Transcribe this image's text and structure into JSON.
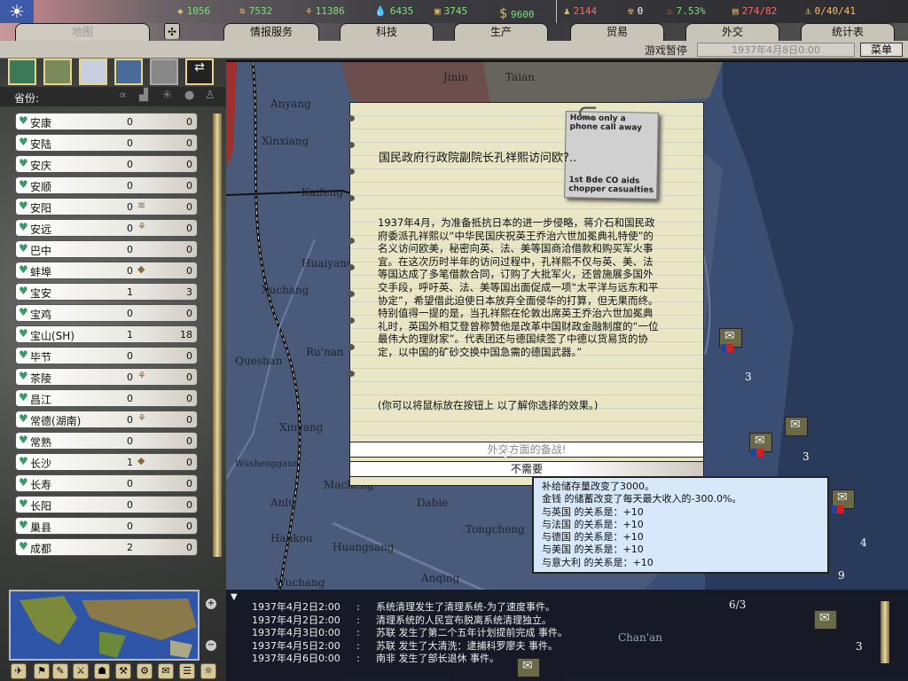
{
  "top": {
    "resources": [
      {
        "icon": "energy-icon",
        "value": "1056"
      },
      {
        "icon": "metal-icon",
        "value": "7532"
      },
      {
        "icon": "rare-materials-icon",
        "value": "11386"
      },
      {
        "icon": "oil-icon",
        "value": "6435"
      },
      {
        "icon": "supplies-icon",
        "value": "3745"
      },
      {
        "icon": "money-icon",
        "value": "9600"
      }
    ],
    "manpower": "2144",
    "nuclear": "0",
    "dissent": "7.53%",
    "transports": "274/82",
    "convoys": "0/40/41"
  },
  "tabs": [
    "地图",
    "情报服务",
    "科技",
    "生产",
    "贸易",
    "外交",
    "统计表"
  ],
  "subbar": {
    "paused": "游戏暂停",
    "date": "1937年4月8日0:00",
    "menu": "菜单"
  },
  "provinces": {
    "header": "省份:",
    "items": [
      {
        "name": "安康",
        "a": "0",
        "b": "0"
      },
      {
        "name": "安陆",
        "a": "0",
        "b": "0"
      },
      {
        "name": "安庆",
        "a": "0",
        "b": "0"
      },
      {
        "name": "安顺",
        "a": "0",
        "b": "0"
      },
      {
        "name": "安阳",
        "a": "0",
        "b": "0",
        "icon": "metal"
      },
      {
        "name": "安远",
        "a": "0",
        "b": "0",
        "icon": "rare"
      },
      {
        "name": "巴中",
        "a": "0",
        "b": "0"
      },
      {
        "name": "蚌埠",
        "a": "0",
        "b": "0",
        "icon": "energy"
      },
      {
        "name": "宝安",
        "a": "1",
        "b": "3"
      },
      {
        "name": "宝鸡",
        "a": "0",
        "b": "0"
      },
      {
        "name": "宝山(SH)",
        "a": "1",
        "b": "18"
      },
      {
        "name": "毕节",
        "a": "0",
        "b": "0"
      },
      {
        "name": "茶陵",
        "a": "0",
        "b": "0",
        "icon": "rare"
      },
      {
        "name": "昌江",
        "a": "0",
        "b": "0"
      },
      {
        "name": "常德(湖南)",
        "a": "0",
        "b": "0",
        "icon": "rare"
      },
      {
        "name": "常熟",
        "a": "0",
        "b": "0"
      },
      {
        "name": "长沙",
        "a": "1",
        "b": "0",
        "icon": "energy"
      },
      {
        "name": "长寿",
        "a": "0",
        "b": "0"
      },
      {
        "name": "长阳",
        "a": "0",
        "b": "0"
      },
      {
        "name": "巢县",
        "a": "0",
        "b": "0"
      },
      {
        "name": "成都",
        "a": "2",
        "b": "0"
      }
    ]
  },
  "map": {
    "cities": [
      "Anyang",
      "Xinxiang",
      "Kaifeng",
      "Xuchang",
      "Huaiyang",
      "Queshan",
      "Ru'nan",
      "Xinyang",
      "Wushenggaun",
      "Anlu",
      "Macheng",
      "Hankou",
      "Huangsang",
      "Anqing",
      "Tongcheng",
      "Chan'an",
      "Dabie",
      "Jinin",
      "Taian",
      "Wuchang"
    ]
  },
  "event": {
    "title": "国民政府行政院副院长孔祥熙访问欧?..",
    "newspaper": {
      "headline": "Home only a phone call away",
      "sub": "1st Bde CO aids chopper casualties"
    },
    "body": "1937年4月，为准备抵抗日本的进一步侵略，蒋介石和国民政府委派孔祥熙以“中华民国庆祝英王乔治六世加冕典礼特使”的名义访问欧美，秘密向英、法、美等国商洽借款和购买军火事宜。在这次历时半年的访问过程中，孔祥熙不仅与英、美、法等国达成了多笔借款合同，订购了大批军火，还曾施展多国外交手段，呼吁英、法、美等国出面促成一项“太平洋与远东和平协定”，希望借此迫使日本放弃全面侵华的打算，但无果而终。特别值得一提的是，当孔祥熙在伦敦出席英王乔治六世加冕典礼时，英国外相艾登曾称赞他是改革中国财政金融制度的“一位最伟大的理财家”。代表团还与德国续签了中德以货易货的协定，以中国的矿砂交换中国急需的德国武器。”",
    "hint": "(你可以将鼠标放在按钮上 以了解你选择的效果。)",
    "options": [
      "外交方面的备战!",
      "不需要"
    ]
  },
  "tooltip": [
    "补给储存量改变了3000。",
    "金钱 的储蓄改变了每天最大收入的-300.0%。",
    "与英国 的关系是：+10",
    "与法国 的关系是：+10",
    "与德国 的关系是：+10",
    "与美国 的关系是：+10",
    "与意大利 的关系是：+10"
  ],
  "log": [
    {
      "time": "1937年4月2日2:00",
      "text": "系统清理发生了清理系统-为了速度事件。"
    },
    {
      "time": "1937年4月2日2:00",
      "text": "清理系统的人民宣布脱离系统清理独立。"
    },
    {
      "time": "1937年4月3日0:00",
      "text": "苏联 发生了第二个五年计划提前完成 事件。"
    },
    {
      "time": "1937年4月5日2:00",
      "text": "苏联 发生了大清洗：逮捕科罗廖夫 事件。"
    },
    {
      "time": "1937年4月6日0:00",
      "text": "南非 发生了部长退休 事件。"
    }
  ],
  "units": [
    "3",
    "3",
    "4",
    "9",
    "3",
    "6/3"
  ],
  "colors": {
    "resource_green": "#7fe07f",
    "resource_red": "#ff6a6a",
    "tooltip_bg": "#d6e8fa",
    "map_sea": "#3a4e74"
  }
}
